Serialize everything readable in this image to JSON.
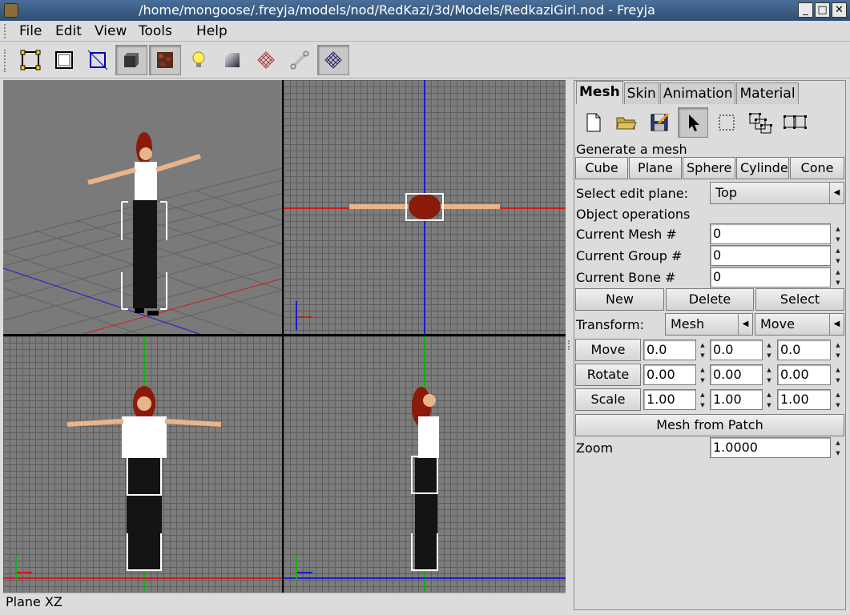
{
  "window": {
    "title": "/home/mongoose/.freyja/models/nod/RedKazi/3d/Models/RedkaziGirl.nod - Freyja"
  },
  "menu": {
    "file": "File",
    "edit": "Edit",
    "view": "View",
    "tools": "Tools",
    "help": "Help"
  },
  "toolbar": {
    "items": [
      "select-all-icon",
      "select-icon",
      "bounding-box-icon",
      "solid-render-icon",
      "texture-render-icon",
      "lighting-icon",
      "material-icon",
      "wireframe-icon",
      "bone-icon",
      "grid-icon"
    ],
    "pressed": [
      "solid-render-icon",
      "texture-render-icon",
      "grid-icon"
    ]
  },
  "status": {
    "text": "Plane XZ"
  },
  "panel": {
    "tabs": [
      "Mesh",
      "Skin",
      "Animation",
      "Material"
    ],
    "active_tab": "Mesh",
    "generate_label": "Generate a mesh",
    "generate_buttons": [
      "Cube",
      "Plane",
      "Sphere",
      "Cylinder",
      "Cone"
    ],
    "edit_plane_label": "Select edit plane:",
    "edit_plane_value": "Top",
    "object_ops_label": "Object operations",
    "current_mesh_label": "Current Mesh  #",
    "current_mesh_value": "0",
    "current_group_label": "Current Group #",
    "current_group_value": "0",
    "current_bone_label": "Current Bone #",
    "current_bone_value": "0",
    "new_label": "New",
    "delete_label": "Delete",
    "select_label": "Select",
    "transform_label": "Transform:",
    "transform_target": "Mesh",
    "transform_mode": "Move",
    "move_label": "Move",
    "move_values": [
      "0.0",
      "0.0",
      "0.0"
    ],
    "rotate_label": "Rotate",
    "rotate_values": [
      "0.00",
      "0.00",
      "0.00"
    ],
    "scale_label": "Scale",
    "scale_values": [
      "1.00",
      "1.00",
      "1.00"
    ],
    "mesh_from_patch_label": "Mesh from Patch",
    "zoom_label": "Zoom",
    "zoom_value": "1.0000"
  }
}
